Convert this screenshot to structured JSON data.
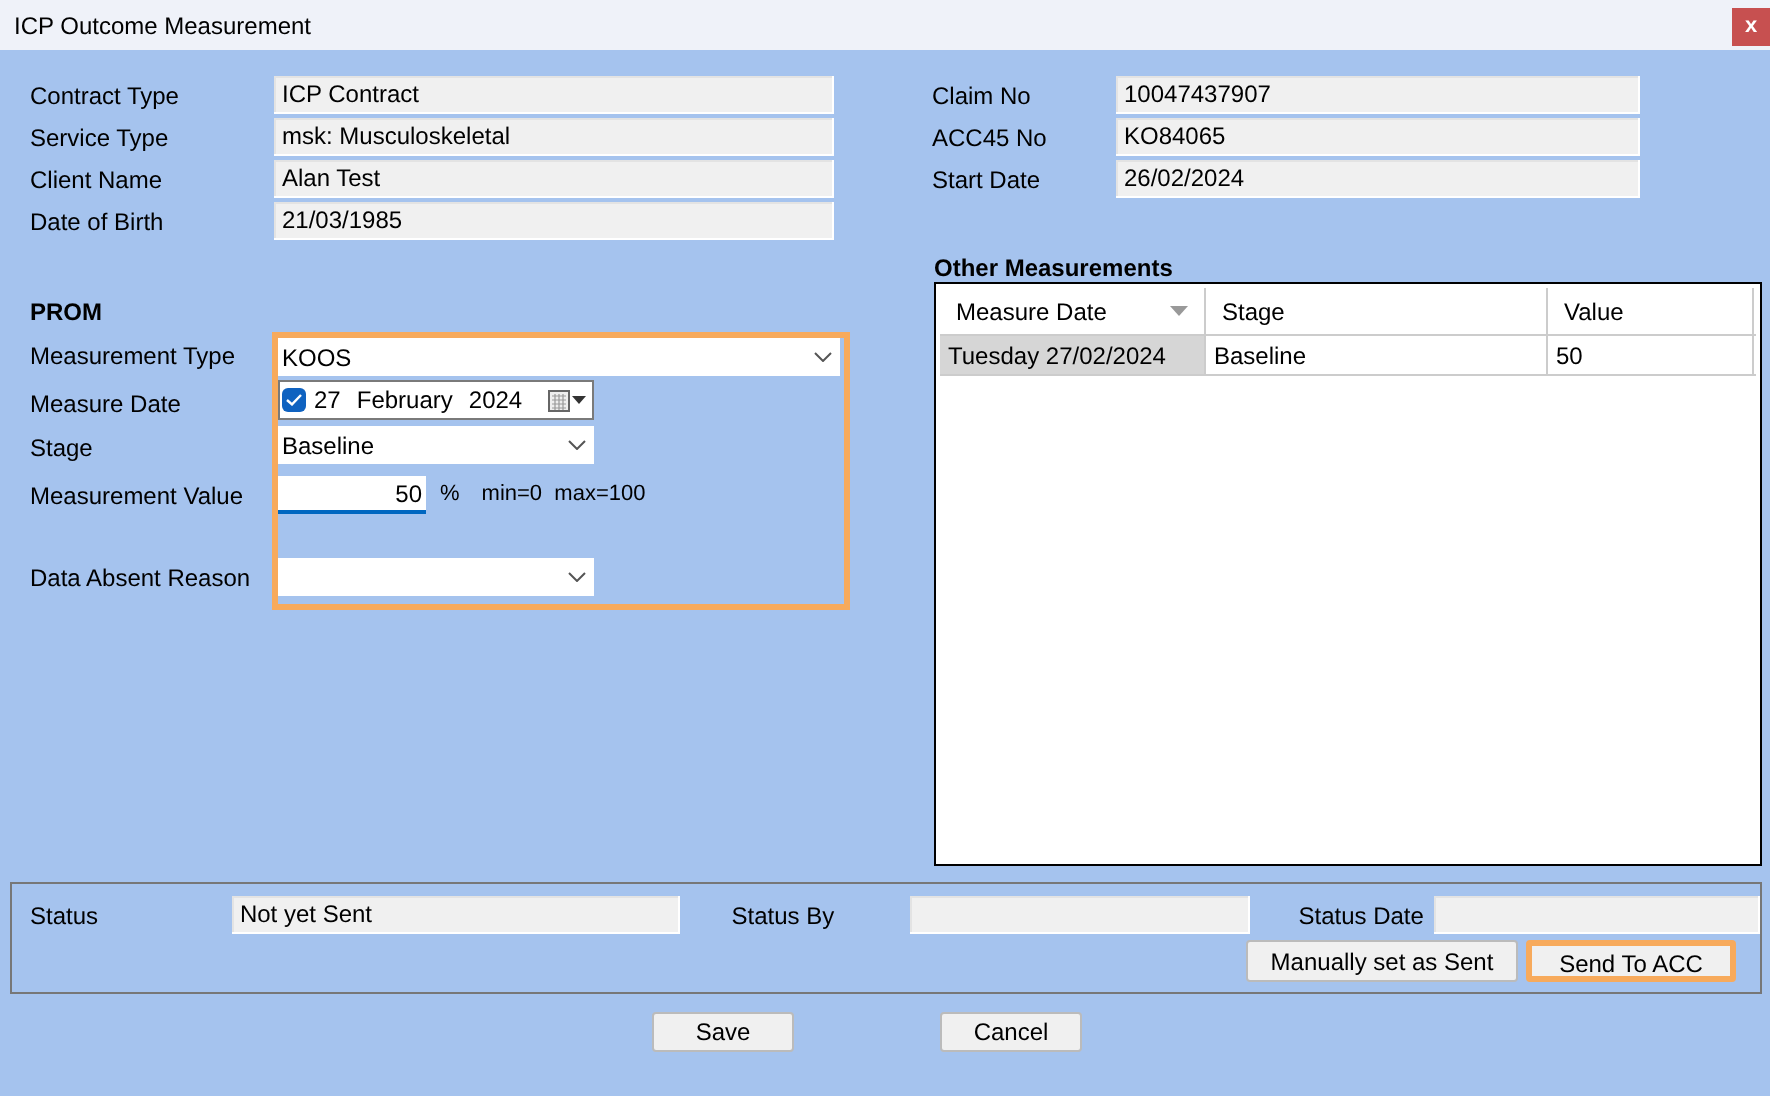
{
  "window": {
    "title": "ICP Outcome Measurement",
    "close": "x"
  },
  "details_left": [
    {
      "label": "Contract Type",
      "value": "ICP Contract"
    },
    {
      "label": "Service Type",
      "value": "msk: Musculoskeletal"
    },
    {
      "label": "Client Name",
      "value": "Alan Test"
    },
    {
      "label": "Date of Birth",
      "value": "21/03/1985"
    }
  ],
  "details_right": [
    {
      "label": "Claim No",
      "value": "10047437907"
    },
    {
      "label": "ACC45 No",
      "value": "KO84065"
    },
    {
      "label": "Start Date",
      "value": "26/02/2024"
    }
  ],
  "prom": {
    "heading": "PROM",
    "highlighted": true,
    "measurement_type": {
      "label": "Measurement Type",
      "value": "KOOS"
    },
    "measure_date": {
      "label": "Measure Date",
      "checked": true,
      "day": "27",
      "month": "February",
      "year": "2024"
    },
    "stage": {
      "label": "Stage",
      "value": "Baseline"
    },
    "measurement_value": {
      "label": "Measurement Value",
      "value": "50",
      "unit": "%",
      "range": "min=0  max=100"
    },
    "data_absent_reason": {
      "label": "Data Absent Reason"
    }
  },
  "other_measurements": {
    "heading": "Other Measurements",
    "columns": [
      "Measure Date",
      "Stage",
      "Value"
    ],
    "rows": [
      {
        "cells": [
          "Tuesday 27/02/2024",
          "Baseline",
          "50"
        ],
        "selected": true
      }
    ]
  },
  "status": {
    "fields": [
      {
        "label": "Status",
        "value": "Not yet Sent"
      },
      {
        "label": "Status By"
      },
      {
        "label": "Status Date"
      }
    ],
    "buttons": [
      {
        "label": "Manually set as Sent",
        "highlighted": false
      },
      {
        "label": "Send To ACC",
        "highlighted": true
      }
    ]
  },
  "buttons": [
    "Save",
    "Cancel"
  ]
}
